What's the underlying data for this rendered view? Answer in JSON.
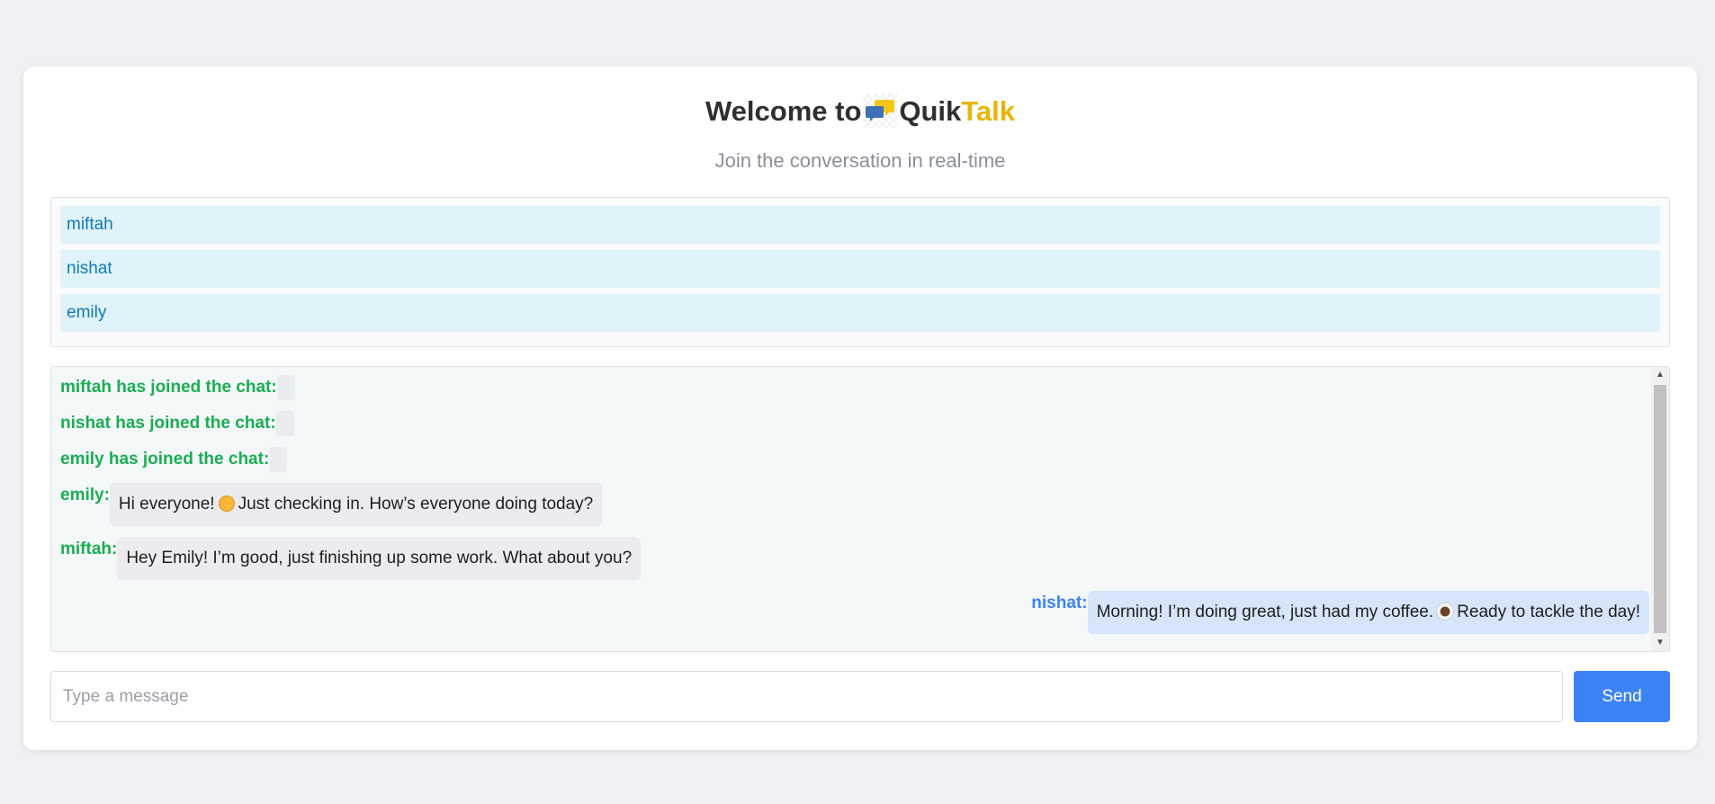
{
  "header": {
    "title_prefix": "Welcome to",
    "brand_part1": "Quik",
    "brand_part2": "Talk",
    "logo_icon": "chat-bubbles-icon",
    "subtitle": "Join the conversation in real-time"
  },
  "users": [
    "miftah",
    "nishat",
    "emily"
  ],
  "messages": [
    {
      "sender": "miftah has joined the chat:",
      "text": "",
      "self": false
    },
    {
      "sender": "nishat has joined the chat:",
      "text": "",
      "self": false
    },
    {
      "sender": "emily has joined the chat:",
      "text": "",
      "self": false
    },
    {
      "sender": "emily:",
      "text_before": "Hi everyone!",
      "emoji": "smiling-face",
      "text_after": "Just checking in. How’s everyone doing today?",
      "self": false
    },
    {
      "sender": "miftah:",
      "text": "Hey Emily! I’m good, just finishing up some work. What about you?",
      "self": false
    },
    {
      "sender": "nishat:",
      "text_before": "Morning! I’m doing great, just had my coffee.",
      "emoji": "coffee",
      "text_after": "Ready to tackle the day!",
      "self": true
    }
  ],
  "composer": {
    "placeholder": "Type a message",
    "value": "",
    "send_label": "Send"
  },
  "colors": {
    "background": "#f0f0f5",
    "brand_accent": "#eab308",
    "system_sender": "#1aae52",
    "self_sender": "#3b82f6",
    "send_button": "#3b82f6",
    "user_item_bg": "#e0f3fa",
    "user_item_text": "#0e7ab8"
  }
}
